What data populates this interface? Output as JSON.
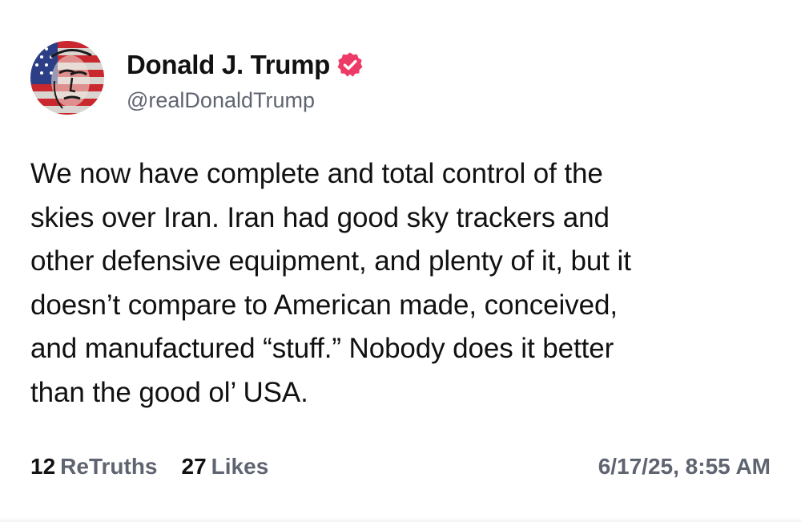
{
  "post": {
    "author": {
      "display_name": "Donald J. Trump",
      "handle": "@realDonaldTrump",
      "verified": true,
      "avatar_icon": "avatar-flag-portrait",
      "verified_icon": "verified-badge-icon",
      "verified_color": "#ee3a66"
    },
    "body_lines": [
      "We now have complete and total control of the",
      "skies over Iran. Iran had good sky trackers and",
      "other defensive equipment, and plenty of it, but it",
      "doesn’t compare to American made, conceived,",
      "and manufactured “stuff.” Nobody does it better",
      "than the good ol’ USA."
    ],
    "stats": {
      "retruths_count": "12",
      "retruths_label": "ReTruths",
      "likes_count": "27",
      "likes_label": "Likes"
    },
    "timestamp": "6/17/25, 8:55 AM"
  }
}
